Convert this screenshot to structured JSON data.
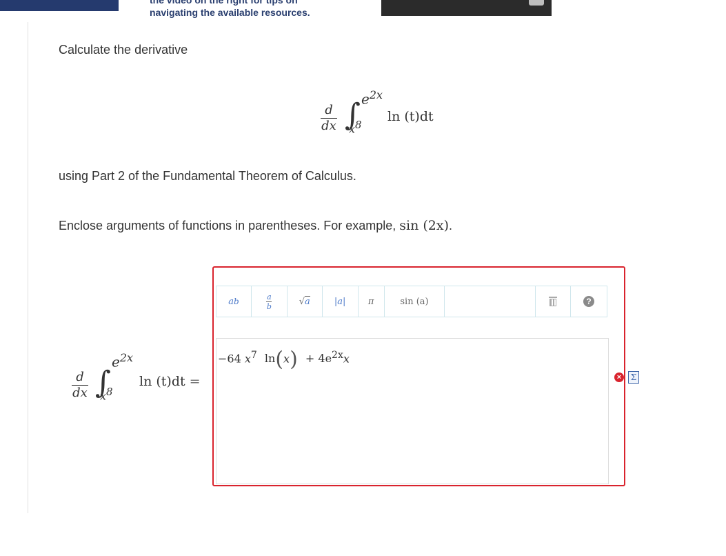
{
  "header": {
    "note_cut": "the video on the right for tips on",
    "note_line": "navigating the available resources."
  },
  "question": {
    "intro": "Calculate the derivative",
    "part2": "using Part 2 of the Fundamental Theorem of Calculus.",
    "instruction_prefix": "Enclose arguments of functions in parentheses. For example, ",
    "instruction_math": "sin (2x)",
    "instruction_suffix": "."
  },
  "integral": {
    "d": "d",
    "dx": "dx",
    "upper": "e",
    "upper_exp": "2x",
    "lower": "x",
    "lower_exp": "8",
    "integrand": "ln (t)dt",
    "equals": "="
  },
  "toolbar": {
    "power_base": "a",
    "power_exp": "b",
    "frac_num": "a",
    "frac_den": "b",
    "sqrt_arg": "a",
    "abs_arg": "|a|",
    "pi": "π",
    "sin": "sin (a)",
    "help": "?"
  },
  "answer": {
    "coef": "−64",
    "var1": "x",
    "exp1": "7",
    "ln": "ln",
    "ln_arg": "x",
    "plus": "+ 4e",
    "exp2": "2x",
    "var2": "x"
  },
  "status": {
    "error_mark": "×",
    "sigma": "Σ"
  },
  "colors": {
    "error_border": "#d9232d",
    "topbar": "#253a6e"
  }
}
